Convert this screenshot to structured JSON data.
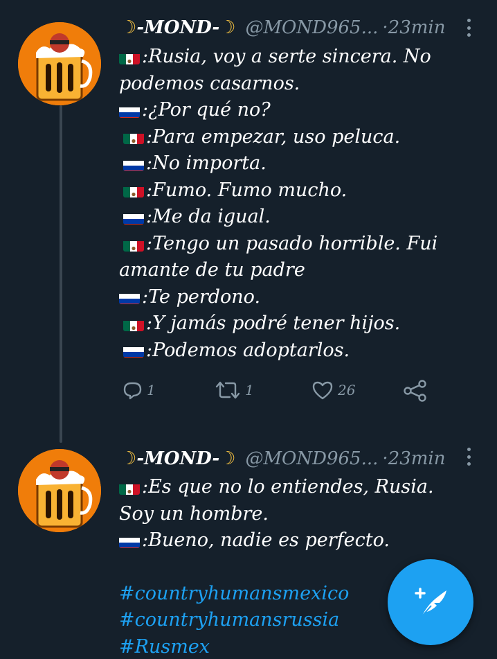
{
  "tweets": [
    {
      "display_name": "-MOND-",
      "moon_left": "☽",
      "moon_right": "☽",
      "handle": "@MOND965...",
      "time": "·23min",
      "lines": [
        {
          "flag": "mx",
          "text": ":Rusia, voy a serte sincera. No podemos casarnos."
        },
        {
          "flag": "ru",
          "text": ":¿Por qué no?"
        },
        {
          "flag": "mx",
          "text": ":Para empezar, uso peluca."
        },
        {
          "flag": "ru",
          "text": ":No importa."
        },
        {
          "flag": "mx",
          "text": ":Fumo. Fumo mucho."
        },
        {
          "flag": "ru",
          "text": ":Me da igual."
        },
        {
          "flag": "mx",
          "text": ":Tengo un pasado horrible. Fui amante de tu padre"
        },
        {
          "flag": "ru",
          "text": ":Te perdono."
        },
        {
          "flag": "mx",
          "text": ":Y jamás podré tener hijos."
        },
        {
          "flag": "ru",
          "text": ":Podemos adoptarlos."
        }
      ],
      "actions": {
        "reply_count": "1",
        "retweet_count": "1",
        "like_count": "26"
      }
    },
    {
      "display_name": "-MOND-",
      "moon_left": "☽",
      "moon_right": "☽",
      "handle": "@MOND965...",
      "time": "·23min",
      "lines": [
        {
          "flag": "mx",
          "text": ":Es que no lo entiendes, Rusia. Soy un hombre."
        },
        {
          "flag": "ru",
          "text": ":Bueno, nadie es perfecto."
        }
      ],
      "hashtags": [
        "#countryhumansmexico",
        "#countryhumansrussia",
        "#Rusmex"
      ]
    }
  ],
  "colors": {
    "background": "#15202b",
    "accent": "#1da1f2",
    "muted": "#8899a6",
    "avatar": "#f07d0a"
  },
  "icons": {
    "reply": "reply-icon",
    "retweet": "retweet-icon",
    "like": "heart-icon",
    "share": "share-icon",
    "compose": "compose-feather-icon"
  }
}
